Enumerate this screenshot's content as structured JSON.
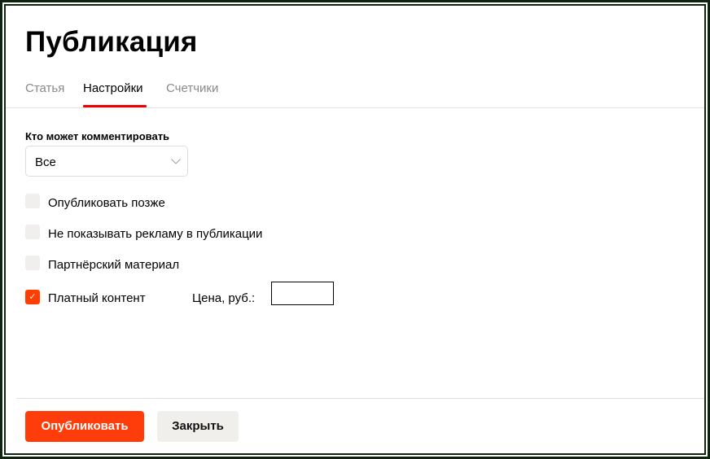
{
  "title": "Публикация",
  "tabs": [
    {
      "label": "Статья",
      "active": false
    },
    {
      "label": "Настройки",
      "active": true
    },
    {
      "label": "Счетчики",
      "active": false
    }
  ],
  "comments": {
    "label": "Кто может комментировать",
    "value": "Все"
  },
  "options": [
    {
      "label": "Опубликовать позже",
      "checked": false
    },
    {
      "label": "Не показывать рекламу в публикации",
      "checked": false
    },
    {
      "label": "Партнёрский материал",
      "checked": false
    },
    {
      "label": "Платный контент",
      "checked": true
    }
  ],
  "price": {
    "label": "Цена, руб.:",
    "value": ""
  },
  "buttons": {
    "publish": "Опубликовать",
    "close": "Закрыть"
  },
  "colors": {
    "accent": "#ff3d0a",
    "frame": "#0f2410"
  }
}
